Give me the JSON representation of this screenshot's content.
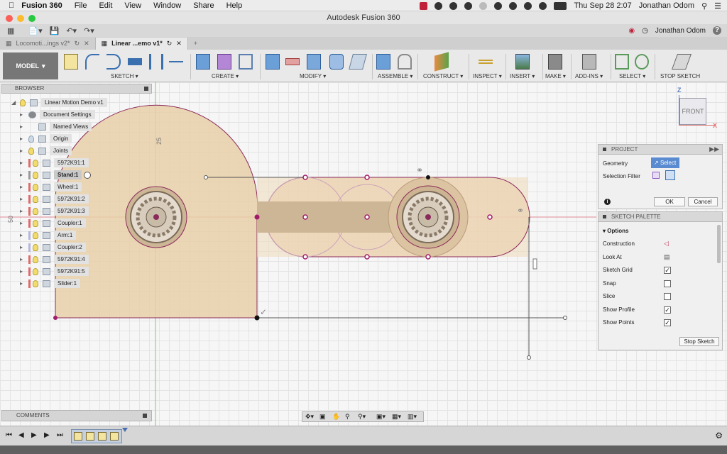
{
  "mac_menu": {
    "apple": "",
    "app": "Fusion 360",
    "items": [
      "File",
      "Edit",
      "View",
      "Window",
      "Share",
      "Help"
    ]
  },
  "menu_right": {
    "clock": "Thu Sep 28  2:07",
    "user": "Jonathan Odom"
  },
  "window_title": "Autodesk Fusion 360",
  "qat": {
    "user": "Jonathan Odom",
    "help": "?"
  },
  "tabs": [
    {
      "label": "Locomoti...ings v2*"
    },
    {
      "label": "Linear ...emo v1*"
    }
  ],
  "toolbar": {
    "workspace": "MODEL",
    "groups": [
      {
        "label": "SKETCH ▾"
      },
      {
        "label": "CREATE ▾"
      },
      {
        "label": "MODIFY ▾"
      },
      {
        "label": "ASSEMBLE ▾"
      },
      {
        "label": "CONSTRUCT ▾"
      },
      {
        "label": "INSPECT ▾"
      },
      {
        "label": "INSERT ▾"
      },
      {
        "label": "MAKE ▾"
      },
      {
        "label": "ADD-INS ▾"
      },
      {
        "label": "SELECT ▾"
      },
      {
        "label": "STOP SKETCH"
      }
    ]
  },
  "browser": {
    "title": "BROWSER",
    "root": "Linear Motion Demo v1",
    "items": [
      {
        "label": "Document Settings"
      },
      {
        "label": "Named Views"
      },
      {
        "label": "Origin"
      },
      {
        "label": "Joints"
      },
      {
        "label": "5972K91:1"
      },
      {
        "label": "Stand:1"
      },
      {
        "label": "Wheel:1"
      },
      {
        "label": "5972K91:2"
      },
      {
        "label": "5972K91:3"
      },
      {
        "label": "Coupler:1"
      },
      {
        "label": "Arm:1"
      },
      {
        "label": "Coupler:2"
      },
      {
        "label": "5972K91:4"
      },
      {
        "label": "5972K91:5"
      },
      {
        "label": "Slider:1"
      }
    ]
  },
  "dimensions": {
    "d1": "25",
    "d2": "50"
  },
  "viewcube": {
    "face": "FRONT",
    "z": "Z",
    "x": "X"
  },
  "project_panel": {
    "title": "PROJECT",
    "geometry_label": "Geometry",
    "select_label": "Select",
    "filter_label": "Selection Filter",
    "ok": "OK",
    "cancel": "Cancel"
  },
  "sketch_palette": {
    "title": "SKETCH PALETTE",
    "section": "Options",
    "rows": [
      {
        "label": "Construction",
        "checked": null
      },
      {
        "label": "Look At",
        "checked": null
      },
      {
        "label": "Sketch Grid",
        "checked": true
      },
      {
        "label": "Snap",
        "checked": false
      },
      {
        "label": "Slice",
        "checked": false
      },
      {
        "label": "Show Profile",
        "checked": true
      },
      {
        "label": "Show Points",
        "checked": true
      }
    ],
    "stop": "Stop Sketch"
  },
  "comments": "COMMENTS",
  "colors": {
    "profile": "#e8cfa8",
    "profile_stroke": "#8a2a5a",
    "point": "#a01b6a",
    "axis_red": "#e06070",
    "axis_green": "#60c060"
  }
}
